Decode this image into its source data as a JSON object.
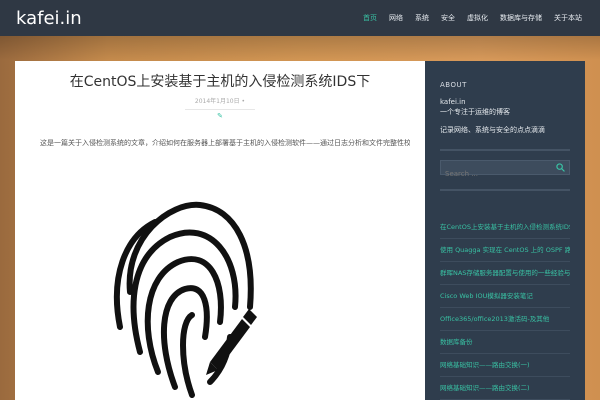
{
  "site": {
    "brand": "kafei.in"
  },
  "nav": {
    "items": [
      {
        "label": "首页",
        "active": true
      },
      {
        "label": "网络"
      },
      {
        "label": "系统"
      },
      {
        "label": "安全"
      },
      {
        "label": "虚拟化"
      },
      {
        "label": "数据库与存储"
      },
      {
        "label": "关于本站"
      }
    ]
  },
  "post": {
    "title": "在CentOS上安装基于主机的入侵检测系统IDS下",
    "meta": "2014年1月10日 •",
    "meta_icon": "✎",
    "excerpt": "这是一篇关于入侵检测系统的文章，介绍如何在服务器上部署基于主机的入侵检测软件——通过日志分析和文件完整性校验来发现可疑行为。"
  },
  "sidebar": {
    "about_title": "ABOUT",
    "about_lines": [
      "kafei.in",
      "一个专注于运维的博客",
      "记录网络、系统与安全的点点滴滴"
    ],
    "search": {
      "placeholder": "Search ..."
    },
    "recent_posts": [
      "在CentOS上安装基于主机的入侵检测系统IDS下",
      "使用 Quagga 实现在 CentOS 上的 OSPF 路由器",
      "群晖NAS存储服务器配置与使用的一些经验与心得分享",
      "Cisco Web IOU模拟器安装笔记",
      "Office365/office2013激活码-及其他",
      "数据库备份",
      "网络基础知识——路由交换(一)",
      "网络基础知识——路由交换(二)"
    ]
  },
  "colors": {
    "accent": "#39c2a4",
    "topbar": "#2f3844",
    "sidebar": "#2f3d4d"
  },
  "icons": {
    "hero": "fingerprint-pen-icon",
    "search": "search-icon",
    "meta": "pencil-icon"
  }
}
